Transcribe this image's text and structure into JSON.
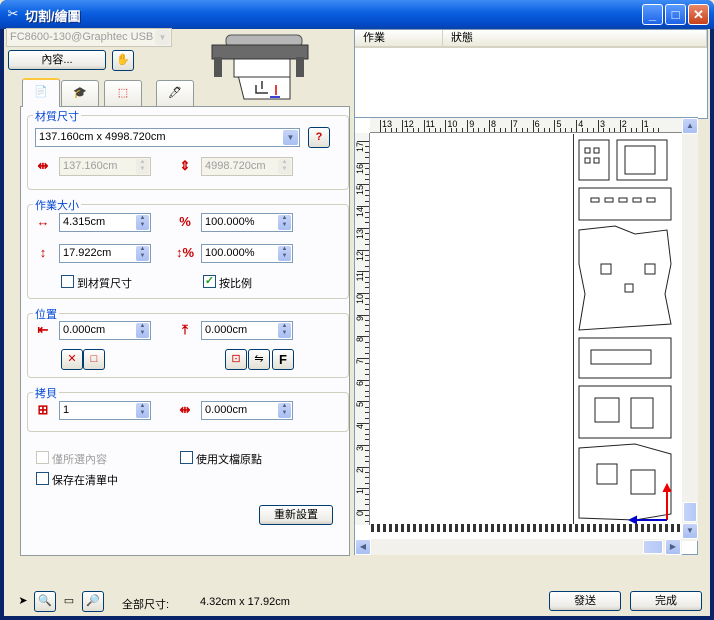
{
  "window": {
    "title": "切割/繪圖",
    "min_label": "_",
    "max_label": "□",
    "close_label": "✕"
  },
  "device": {
    "selected": "FC8600-130@Graphtec USB",
    "content_button": "內容..."
  },
  "job_list": {
    "columns": [
      "作業",
      "狀態"
    ]
  },
  "tabs": [
    {
      "name": "tab-cut",
      "icon": "cut-settings-icon",
      "active": true
    },
    {
      "name": "tab-options",
      "icon": "options-icon",
      "active": false
    },
    {
      "name": "tab-layout",
      "icon": "layout-icon",
      "active": false
    },
    {
      "name": "tab-tool",
      "icon": "tool-icon",
      "active": false
    }
  ],
  "media": {
    "label": "材質尺寸",
    "selected": "137.160cm x 4998.720cm",
    "width": "137.160cm",
    "height": "4998.720cm"
  },
  "job_size": {
    "label": "作業大小",
    "width": "4.315cm",
    "height": "17.922cm",
    "scale_x": "100.000%",
    "scale_y": "100.000%",
    "fit_media_label": "到材質尺寸",
    "fit_media_checked": false,
    "proportional_label": "按比例",
    "proportional_checked": true
  },
  "position": {
    "label": "位置",
    "x": "0.000cm",
    "y": "0.000cm",
    "f_button": "F"
  },
  "copies": {
    "label": "拷貝",
    "count": "1",
    "spacing": "0.000cm"
  },
  "options": {
    "selected_only_label": "僅所選內容",
    "use_doc_origin_label": "使用文檔原點",
    "save_in_list_label": "保存在清單中"
  },
  "reset_button": "重新設置",
  "preview": {
    "ruler_h": [
      "13",
      "12",
      "11",
      "10",
      "9",
      "8",
      "7",
      "6",
      "5",
      "4",
      "3",
      "2",
      "1"
    ],
    "ruler_v": [
      "17",
      "16",
      "15",
      "14",
      "13",
      "12",
      "11",
      "10",
      "9",
      "8",
      "7",
      "6",
      "5",
      "4",
      "3",
      "2",
      "1",
      "0"
    ]
  },
  "status": {
    "total_size_label": "全部尺寸:",
    "total_size_value": "4.32cm x 17.92cm"
  },
  "send_button": "發送",
  "done_button": "完成"
}
